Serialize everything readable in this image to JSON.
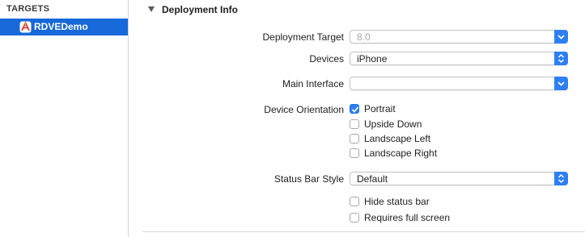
{
  "sidebar": {
    "header": "TARGETS",
    "items": [
      {
        "label": "RDVEDemo",
        "icon": "app-target-icon",
        "selected": true
      }
    ]
  },
  "section": {
    "title": "Deployment Info",
    "expanded": true
  },
  "fields": {
    "deployment_target": {
      "label": "Deployment Target",
      "value": "8.0"
    },
    "devices": {
      "label": "Devices",
      "value": "iPhone"
    },
    "main_interface": {
      "label": "Main Interface",
      "value": ""
    },
    "device_orientation": {
      "label": "Device Orientation",
      "options": [
        {
          "label": "Portrait",
          "checked": true
        },
        {
          "label": "Upside Down",
          "checked": false
        },
        {
          "label": "Landscape Left",
          "checked": false
        },
        {
          "label": "Landscape Right",
          "checked": false
        }
      ]
    },
    "status_bar_style": {
      "label": "Status Bar Style",
      "value": "Default"
    },
    "hide_status_bar": {
      "label": "Hide status bar",
      "checked": false
    },
    "requires_full_screen": {
      "label": "Requires full screen",
      "checked": false
    }
  },
  "colors": {
    "accent": "#2e7ff3",
    "selection": "#1768d8"
  }
}
